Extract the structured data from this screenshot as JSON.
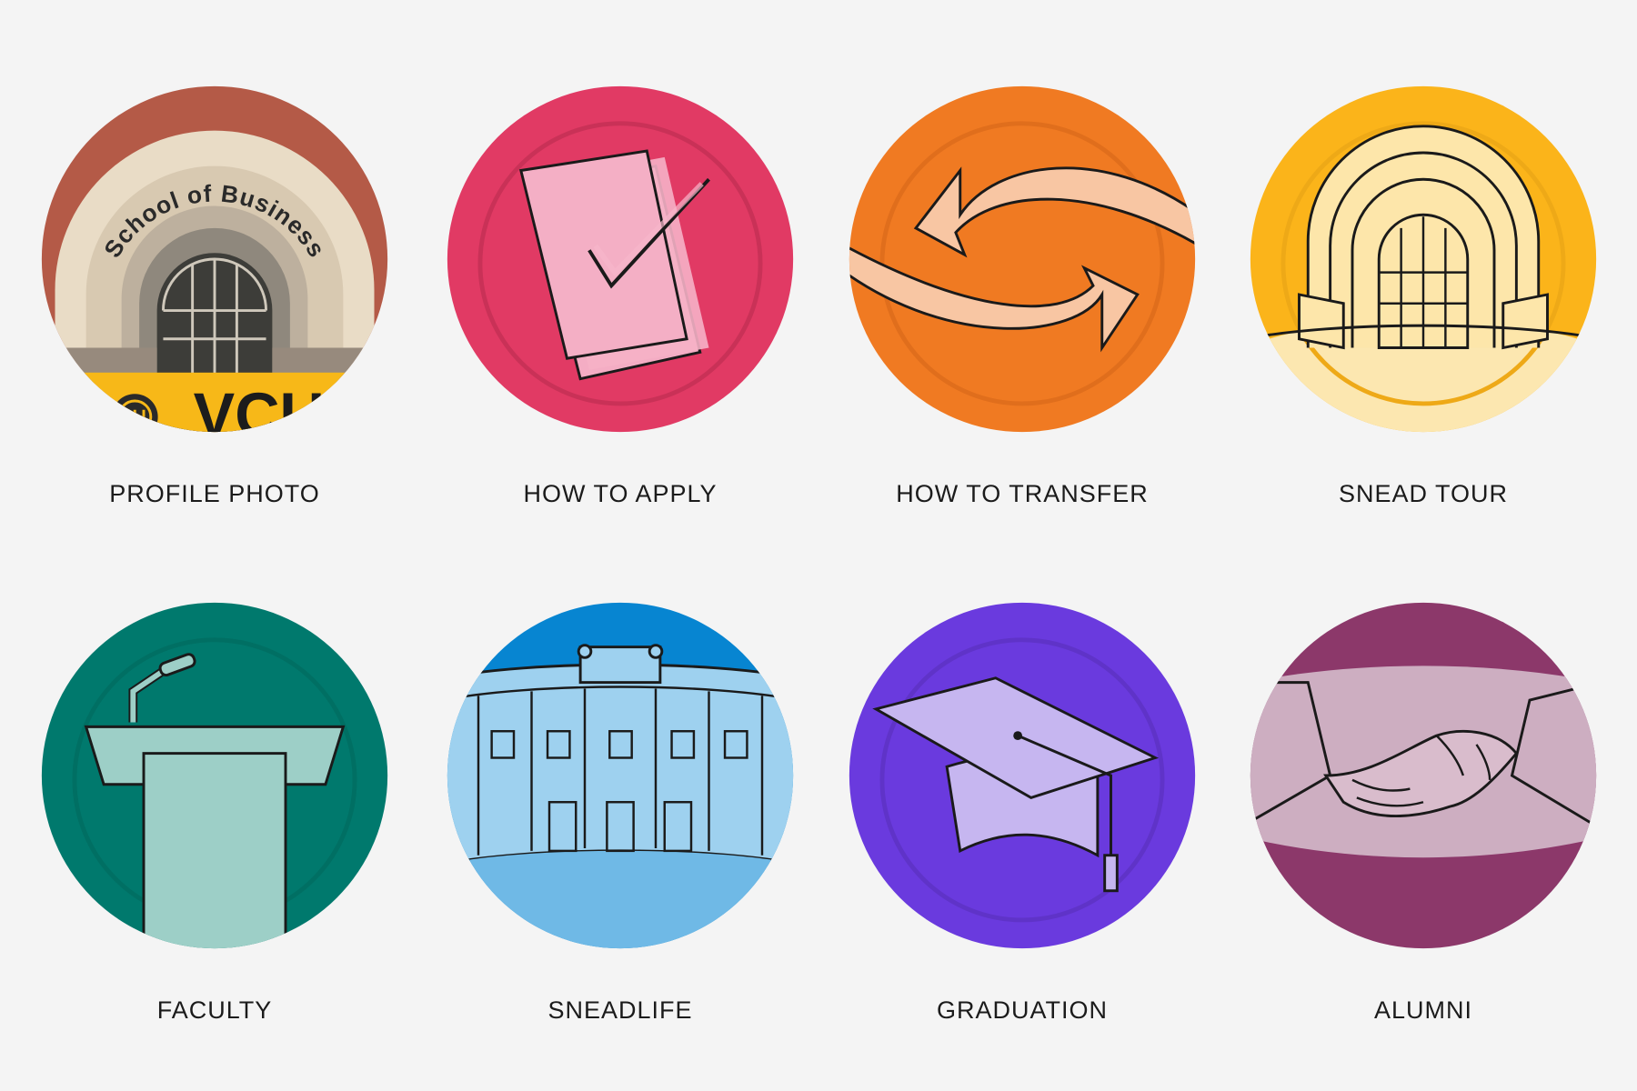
{
  "tiles": [
    {
      "label": "PROFILE PHOTO",
      "icon": "school-of-business-arch-icon",
      "color": "#fbbb14",
      "arch_text": "School of Business",
      "logo_text": "VCU"
    },
    {
      "label": "HOW TO APPLY",
      "icon": "checklist-document-icon",
      "color": "#e13a64"
    },
    {
      "label": "HOW TO TRANSFER",
      "icon": "transfer-arrows-icon",
      "color": "#f07a22"
    },
    {
      "label": "SNEAD TOUR",
      "icon": "arch-doorway-icon",
      "color": "#fbb41a"
    },
    {
      "label": "FACULTY",
      "icon": "podium-icon",
      "color": "#00796d"
    },
    {
      "label": "SNEADLIFE",
      "icon": "building-facade-icon",
      "color": "#0785d1"
    },
    {
      "label": "GRADUATION",
      "icon": "graduation-cap-icon",
      "color": "#6a3ade"
    },
    {
      "label": "ALUMNI",
      "icon": "handshake-icon",
      "color": "#8c386a"
    }
  ]
}
